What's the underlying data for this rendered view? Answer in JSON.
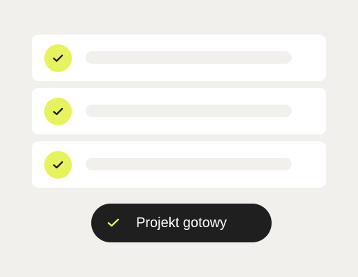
{
  "tasks": [
    {
      "status": "done",
      "icon": "checkmark-icon"
    },
    {
      "status": "done",
      "icon": "checkmark-icon"
    },
    {
      "status": "done",
      "icon": "checkmark-icon"
    }
  ],
  "toast": {
    "icon": "checkmark-icon",
    "label": "Projekt gotowy"
  },
  "colors": {
    "background": "#f1f0ed",
    "card": "#ffffff",
    "accent": "#e6f35c",
    "toast_background": "#1f1f1f",
    "toast_text": "#ffffff"
  }
}
